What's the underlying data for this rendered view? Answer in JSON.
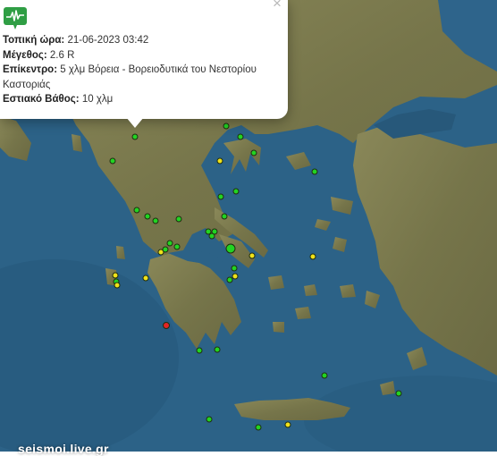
{
  "popup": {
    "close_glyph": "×",
    "icon": "seismograph-icon",
    "local_time_label": "Τοπική ώρα:",
    "local_time_value": "21-06-2023 03:42",
    "magnitude_label": "Μέγεθος:",
    "magnitude_value": "2.6 R",
    "epicenter_label": "Επίκεντρο:",
    "epicenter_value": "5 χλμ Βόρεια - Βορειοδυτικά του Νεστορίου Καστοριάς",
    "depth_label": "Εστιακό Βάθος:",
    "depth_value": "10 χλμ"
  },
  "watermark": "seismoi.live.gr",
  "colors": {
    "sea": "#2a5f83",
    "land": "#7d7c50",
    "green_marker": "#22d422",
    "yellow_marker": "#f0e21a",
    "red_marker": "#e32424"
  }
}
